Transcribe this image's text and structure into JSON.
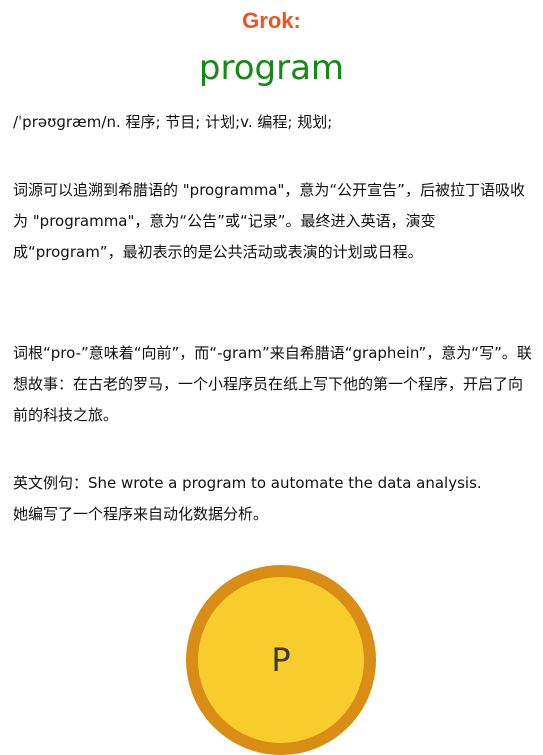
{
  "header": {
    "brand": "Grok:",
    "word": "program"
  },
  "definition": "/ˈprəʊɡræm/n. 程序; 节目; 计划;v. 编程; 规划;",
  "etymology": "词源可以追溯到希腊语的 \"programma\"，意为“公开宣告”，后被拉丁语吸收为 \"programma\"，意为“公告”或“记录”。最终进入英语，演变成“program”，最初表示的是公共活动或表演的计划或日程。",
  "root": "词根“pro-”意味着“向前”，而“-gram”来自希腊语“graphein”，意为“写”。联想故事：在古老的罗马，一个小程序员在纸上写下他的第一个程序，开启了向前的科技之旅。",
  "example": {
    "en": "英文例句：She wrote a program to automate the data analysis.",
    "zh": "她编写了一个程序来自动化数据分析。"
  },
  "coin": {
    "letter": "P",
    "fill_color": "#f9cc2e",
    "border_color": "#d98d14"
  },
  "colors": {
    "brand": "#f4511e",
    "word": "#138a13"
  }
}
